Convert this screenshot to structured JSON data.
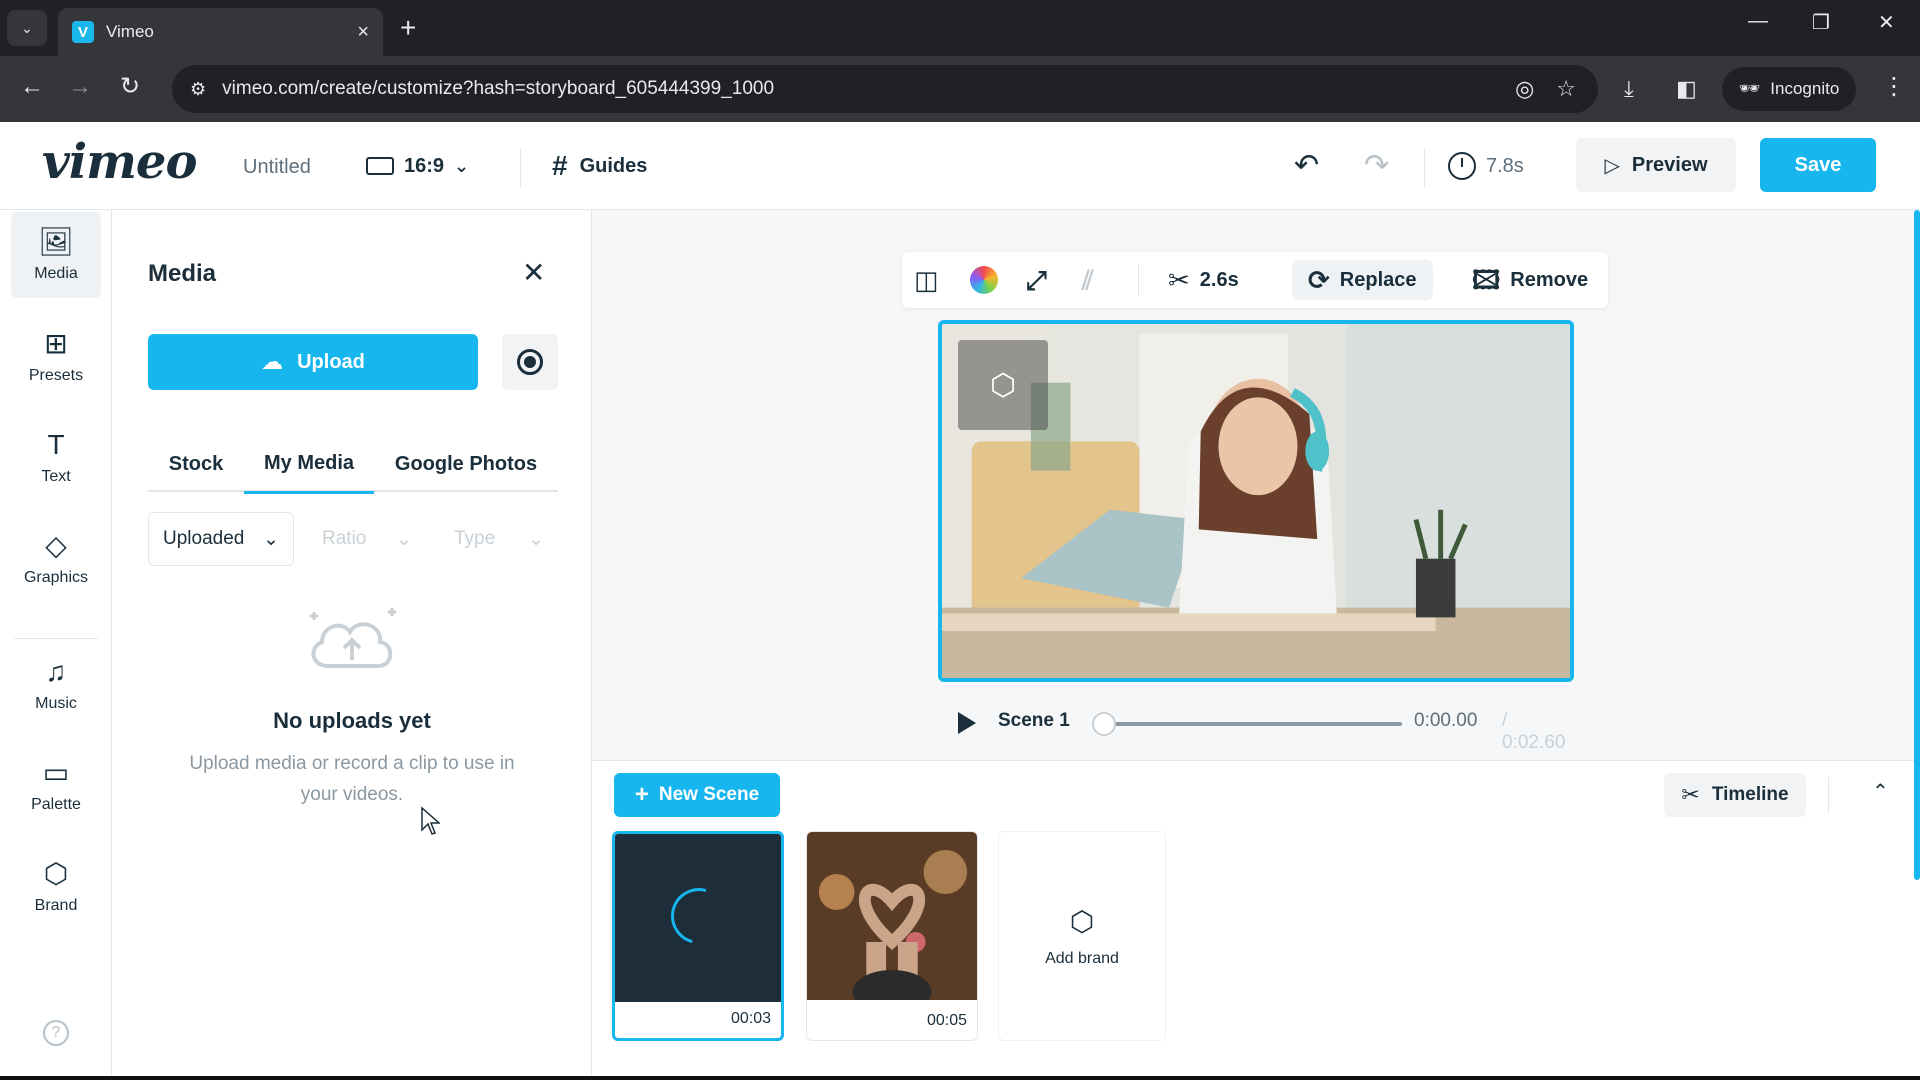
{
  "browser": {
    "tab_title": "Vimeo",
    "tab_favicon": "V",
    "url": "vimeo.com/create/customize?hash=storyboard_605444399_1000",
    "incognito_label": "Incognito"
  },
  "header": {
    "logo": "vimeo",
    "doc_title": "Untitled",
    "ratio": "16:9",
    "guides": "Guides",
    "duration": "7.8s",
    "preview": "Preview",
    "save": "Save"
  },
  "rail": {
    "items": [
      {
        "label": "Media",
        "icon": "image-icon"
      },
      {
        "label": "Presets",
        "icon": "grid-icon"
      },
      {
        "label": "Text",
        "icon": "text-icon"
      },
      {
        "label": "Graphics",
        "icon": "shapes-icon"
      },
      {
        "label": "Music",
        "icon": "music-note-icon"
      },
      {
        "label": "Palette",
        "icon": "palette-icon"
      },
      {
        "label": "Brand",
        "icon": "brand-icon"
      }
    ]
  },
  "media_panel": {
    "title": "Media",
    "upload": "Upload",
    "tabs": [
      "Stock",
      "My Media",
      "Google Photos"
    ],
    "active_tab": "My Media",
    "filters": [
      "Uploaded",
      "Ratio",
      "Type"
    ],
    "empty_title": "No uploads yet",
    "empty_sub": "Upload media or record a clip to use in your videos."
  },
  "stage": {
    "trim": "2.6s",
    "replace": "Replace",
    "remove": "Remove",
    "scene_label": "Scene 1",
    "time_current": "0:00.00",
    "time_total": "/ 0:02.60",
    "progress": 0
  },
  "scenes": {
    "new_scene": "New Scene",
    "timeline": "Timeline",
    "items": [
      {
        "duration": "00:03",
        "selected": true
      },
      {
        "duration": "00:05",
        "selected": false
      }
    ],
    "add_brand": "Add brand"
  },
  "colors": {
    "accent": "#17b6ee",
    "text": "#1a2e3b",
    "muted": "#8a98a3"
  }
}
